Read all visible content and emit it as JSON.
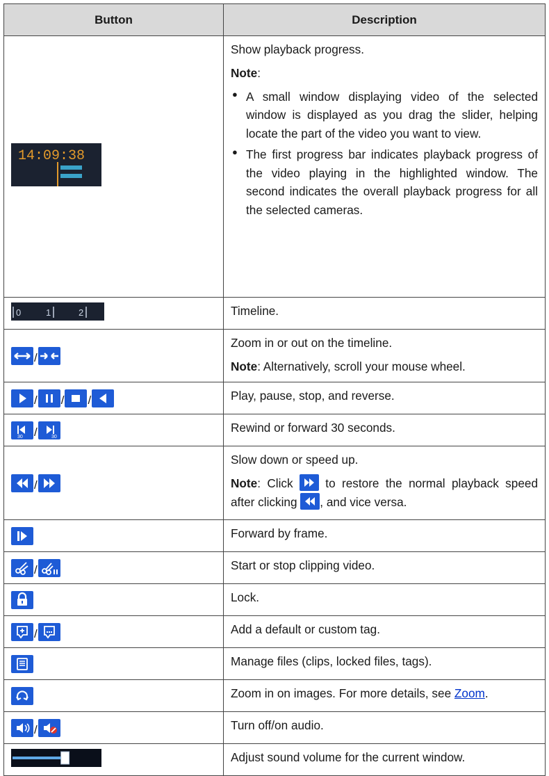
{
  "headers": {
    "button": "Button",
    "description": "Description"
  },
  "rows": [
    {
      "text": "Show playback progress.",
      "note_label": "Note",
      "note_colon": ":",
      "bullets": [
        "A small window displaying video of the selected window is displayed as you drag the slider, helping locate the part of the video you want to view.",
        "The first progress bar indicates playback progress of the video playing in the highlighted window. The second indicates the overall playback progress for all the selected cameras."
      ],
      "thumb_time": "14:09:38"
    },
    {
      "text": "Timeline.",
      "timeline_ticks": [
        "0",
        "1",
        "2"
      ]
    },
    {
      "text": "Zoom in or out on the timeline.",
      "note_label": "Note",
      "note_text": ": Alternatively, scroll your mouse wheel."
    },
    {
      "text": "Play, pause, stop, and reverse."
    },
    {
      "text": "Rewind or forward 30 seconds."
    },
    {
      "text": "Slow down or speed up.",
      "note_label": "Note",
      "note_a": ": Click ",
      "note_b": " to restore the normal playback speed after clicking ",
      "note_c": ", and vice versa."
    },
    {
      "text": "Forward by frame."
    },
    {
      "text": "Start or stop clipping video."
    },
    {
      "text": "Lock."
    },
    {
      "text": "Add a default or custom tag."
    },
    {
      "text": "Manage files (clips, locked files, tags)."
    },
    {
      "text": "Zoom in on images. For more details, see ",
      "link": "Zoom",
      "after_link": "."
    },
    {
      "text": "Turn off/on audio."
    },
    {
      "text": "Adjust sound volume for the current window.",
      "volume_level": 0.6
    }
  ],
  "separator": "/",
  "colors": {
    "icon_bg": "#1e5bd6",
    "header_bg": "#d9d9d9",
    "link": "#0033cc",
    "dark_panel": "#1b2230",
    "progress": "#3aa3c9",
    "time_text": "#e39a2b"
  }
}
